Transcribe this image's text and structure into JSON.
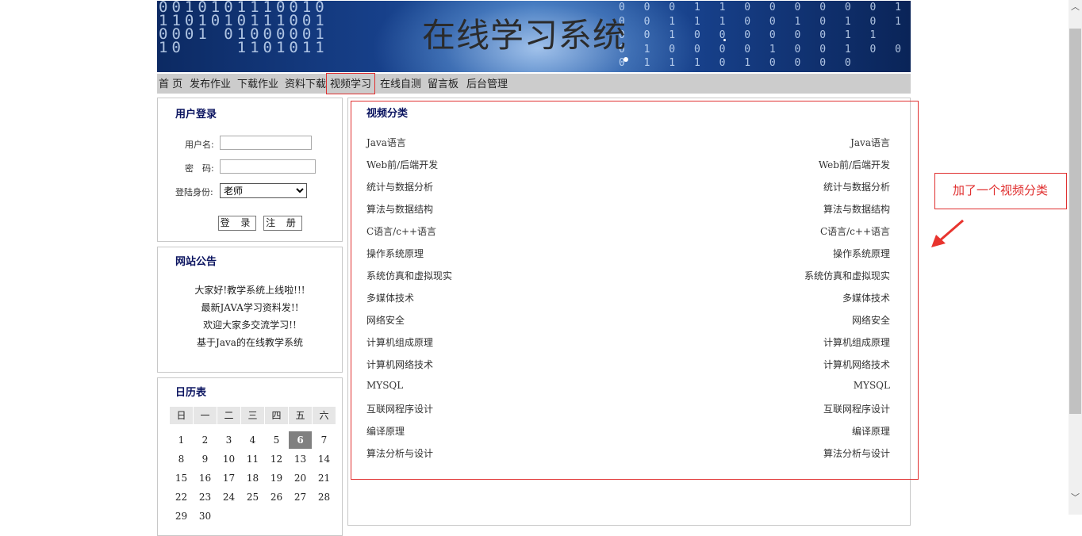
{
  "site": {
    "title": "在线学习系统"
  },
  "nav": [
    "首 页",
    "发布作业",
    "下载作业",
    "资料下载",
    "视频学习",
    "在线自测",
    "留言板",
    "后台管理"
  ],
  "nav_active_index": 4,
  "login": {
    "title": "用户登录",
    "username_label": "用户名:",
    "password_label": "密　码:",
    "role_label": "登陆身份:",
    "role_selected": "老师",
    "login_button": "登 录",
    "register_button": "注 册"
  },
  "notice": {
    "title": "网站公告",
    "lines": [
      "大家好!教学系统上线啦!!!",
      "最新JAVA学习资料发!!",
      "欢迎大家多交流学习!!",
      "基于Java的在线教学系统"
    ]
  },
  "calendar": {
    "title": "日历表",
    "weekdays": [
      "日",
      "一",
      "二",
      "三",
      "四",
      "五",
      "六"
    ],
    "today": 6,
    "weeks": [
      [
        "1",
        "2",
        "3",
        "4",
        "5",
        "6",
        "7"
      ],
      [
        "8",
        "9",
        "10",
        "11",
        "12",
        "13",
        "14"
      ],
      [
        "15",
        "16",
        "17",
        "18",
        "19",
        "20",
        "21"
      ],
      [
        "22",
        "23",
        "24",
        "25",
        "26",
        "27",
        "28"
      ],
      [
        "29",
        "30",
        "",
        "",
        "",
        "",
        ""
      ]
    ]
  },
  "video_category": {
    "title": "视频分类",
    "items": [
      "Java语言",
      "Web前/后端开发",
      "统计与数据分析",
      "算法与数据结构",
      "C语言/c++语言",
      "操作系统原理",
      "系统仿真和虚拟现实",
      "多媒体技术",
      "网络安全",
      "计算机组成原理",
      "计算机网络技术",
      "MYSQL",
      "互联网程序设计",
      "编译原理",
      "算法分析与设计"
    ]
  },
  "annotation": {
    "text": "加了一个视频分类"
  },
  "colors": {
    "accent_red": "#e03030",
    "heading_navy": "#0b1460",
    "nav_bg": "#cccccc"
  }
}
